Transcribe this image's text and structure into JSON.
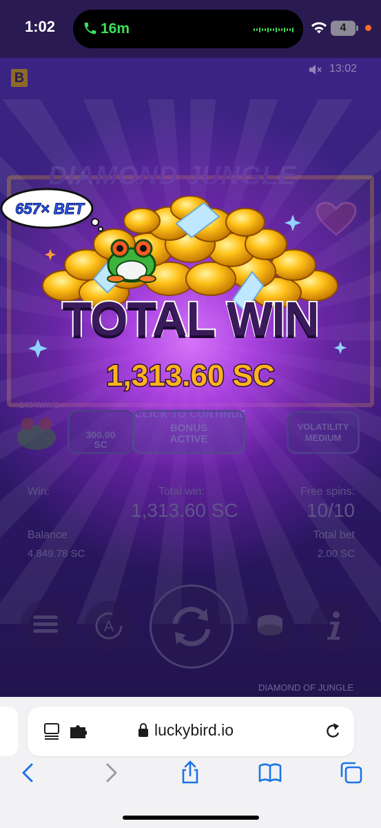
{
  "status_bar": {
    "time": "1:02",
    "call_duration": "16m",
    "battery_level": "4"
  },
  "game": {
    "brand_letter": "B",
    "clock": "13:02",
    "logo_text": "DIAMOND JUNGLE",
    "ways": "243 WAYS",
    "multiplier_badge": "657× BET",
    "total_win_title": "TOTAL WIN",
    "total_win_amount": "1,313.60 SC",
    "click_to_continue": "CLICK TO CONTINUE",
    "bet_value": "300.00\nSC",
    "bonus_line1": "BONUS",
    "bonus_line2": "ACTIVE",
    "volatility_label": "VOLATILITY",
    "volatility_value": "MEDIUM",
    "name_footer": "DIAMOND OF JUNGLE"
  },
  "info_panel": {
    "win_label": "Win:",
    "total_win_label": "Total win:",
    "total_win_value": "1,313.60 SC",
    "free_spins_label": "Free spins:",
    "free_spins_value": "10/10",
    "balance_label": "Balance",
    "balance_value": "4,849.78 SC",
    "total_bet_label": "Total bet",
    "total_bet_value": "2.00 SC"
  },
  "browser": {
    "url": "luckybird.io"
  },
  "colors": {
    "accent_gold": "#ffb21e",
    "call_green": "#3fe05a",
    "safari_blue": "#1a73e8"
  }
}
